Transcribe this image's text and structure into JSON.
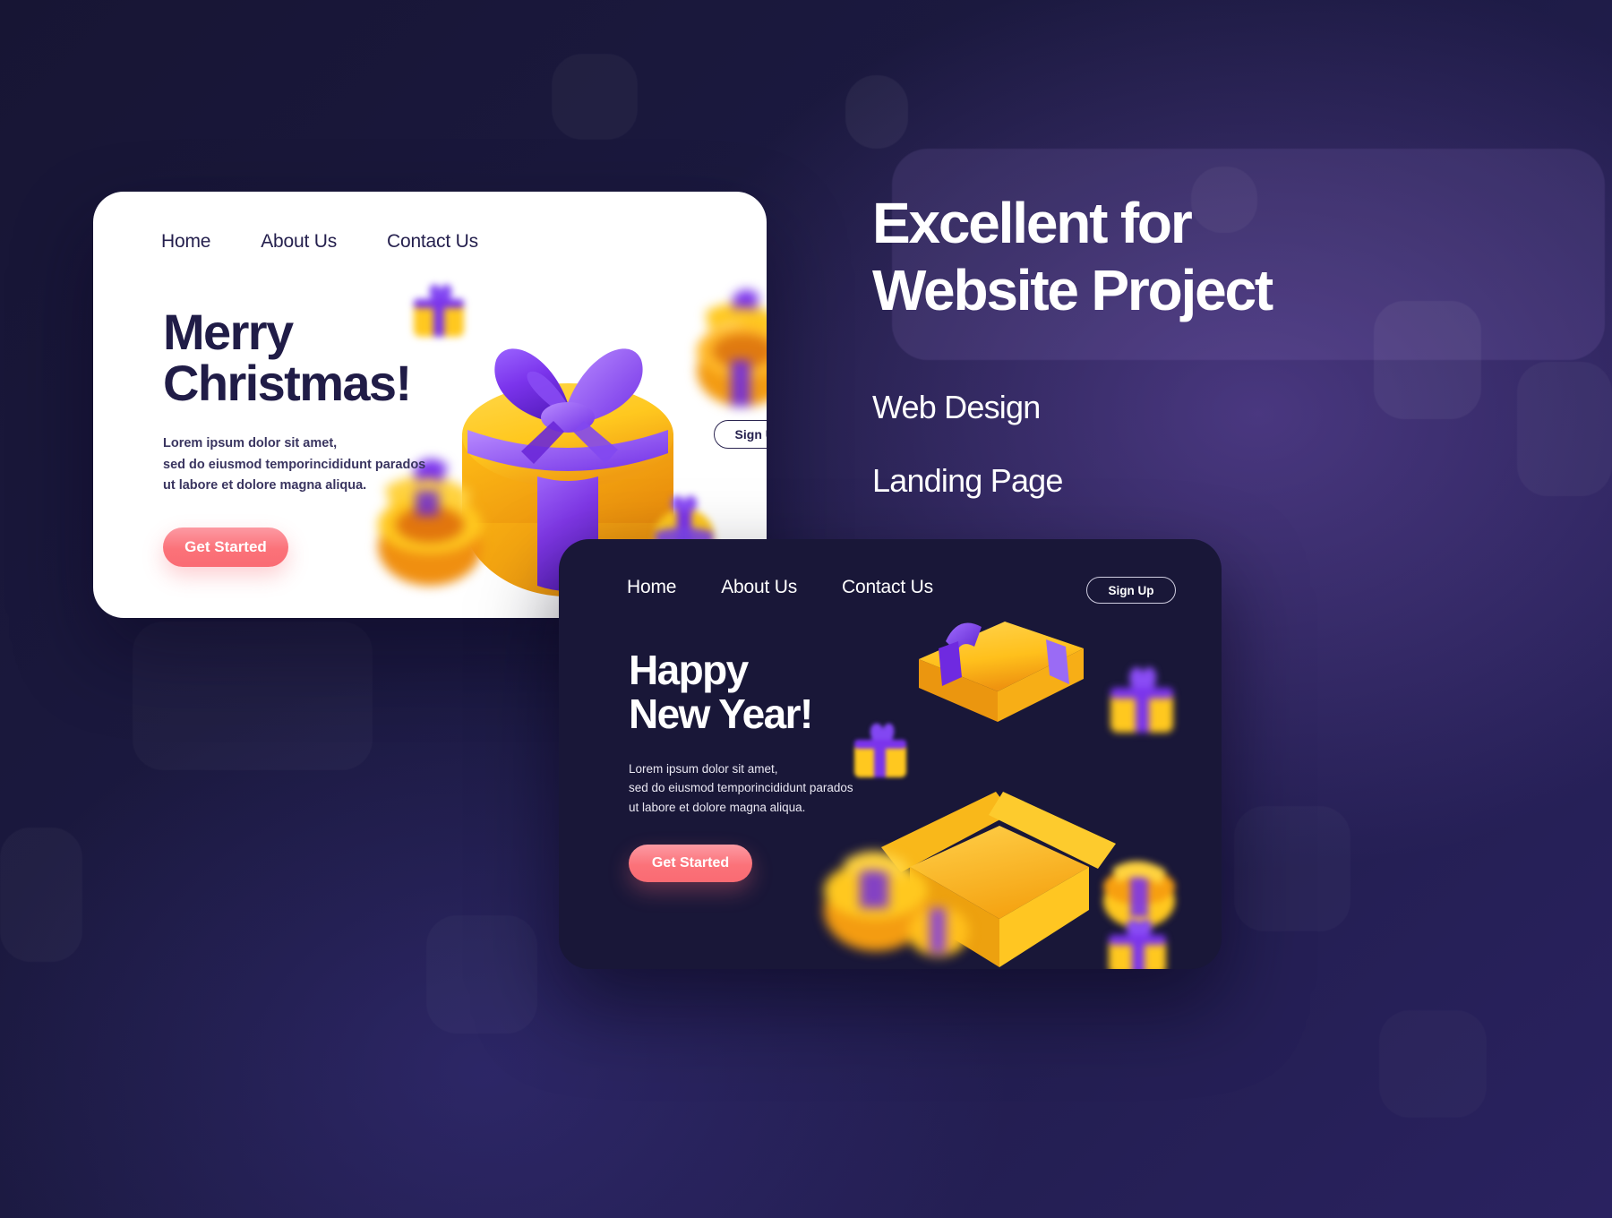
{
  "theme": {
    "background": "#1a1840",
    "light_card_bg": "#ffffff",
    "dark_card_bg": "#191738",
    "ink": "#201c47",
    "cta_pink": "#fa6b73",
    "gift_yellow": "#ffc81f",
    "gift_purple": "#6d2fe0"
  },
  "light_card": {
    "nav": [
      {
        "label": "Home"
      },
      {
        "label": "About Us"
      },
      {
        "label": "Contact Us"
      }
    ],
    "signup_label": "Sign Up",
    "headline_line1": "Merry",
    "headline_line2": "Christmas!",
    "body_line1": "Lorem ipsum dolor sit amet,",
    "body_line2": "sed do eiusmod temporincididunt parados",
    "body_line3": "ut labore et dolore magna aliqua.",
    "cta_label": "Get Started"
  },
  "dark_card": {
    "nav": [
      {
        "label": "Home"
      },
      {
        "label": "About Us"
      },
      {
        "label": "Contact Us"
      }
    ],
    "signup_label": "Sign Up",
    "headline_line1": "Happy",
    "headline_line2": "New Year!",
    "body_line1": "Lorem ipsum dolor sit amet,",
    "body_line2": "sed do eiusmod temporincididunt parados",
    "body_line3": "ut labore et dolore magna aliqua.",
    "cta_label": "Get Started"
  },
  "promo": {
    "title_line1": "Excellent for",
    "title_line2": "Website Project",
    "items": [
      {
        "label": "Web Design"
      },
      {
        "label": "Landing Page"
      }
    ]
  }
}
